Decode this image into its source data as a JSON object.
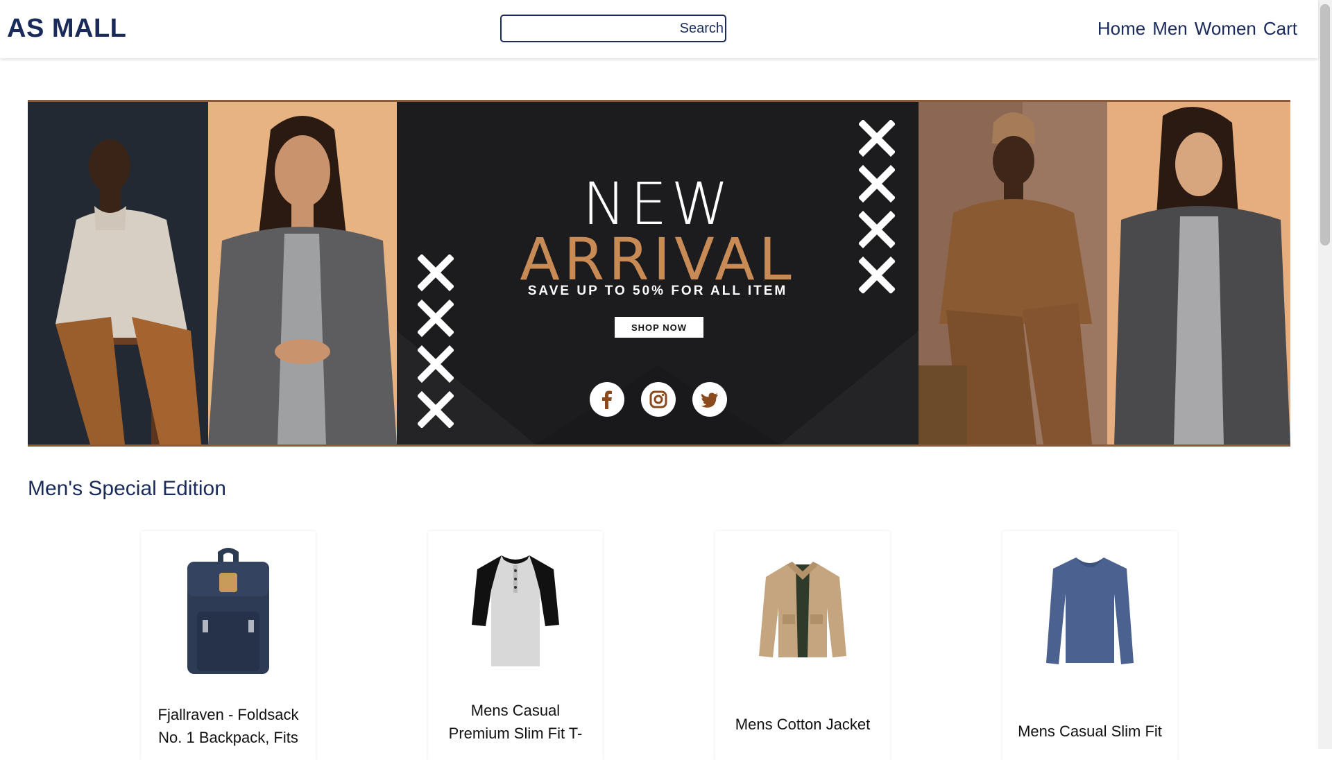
{
  "header": {
    "logo": "AS MALL",
    "search_placeholder": "",
    "search_button": "Search",
    "nav": [
      "Home",
      "Men",
      "Women",
      "Cart"
    ]
  },
  "banner": {
    "headline_1": "NEW",
    "headline_2": "ARRIVAL",
    "subtitle": "SAVE UP TO 50% FOR ALL ITEM",
    "cta": "SHOP NOW",
    "social_icons": [
      "facebook-icon",
      "instagram-icon",
      "twitter-icon"
    ],
    "colors": {
      "accent": "#c98b56",
      "dark": "#1c1b1d"
    }
  },
  "section": {
    "title": "Men's Special Edition",
    "products": [
      {
        "title": "Fjallraven - Foldsack No. 1 Backpack, Fits",
        "icon": "backpack"
      },
      {
        "title": "Mens Casual Premium Slim Fit T-",
        "icon": "raglan-tshirt"
      },
      {
        "title": "Mens Cotton Jacket",
        "icon": "jacket"
      },
      {
        "title": "Mens Casual Slim Fit",
        "icon": "longsleeve-shirt"
      }
    ]
  },
  "colors": {
    "brand": "#1a2a5a"
  }
}
